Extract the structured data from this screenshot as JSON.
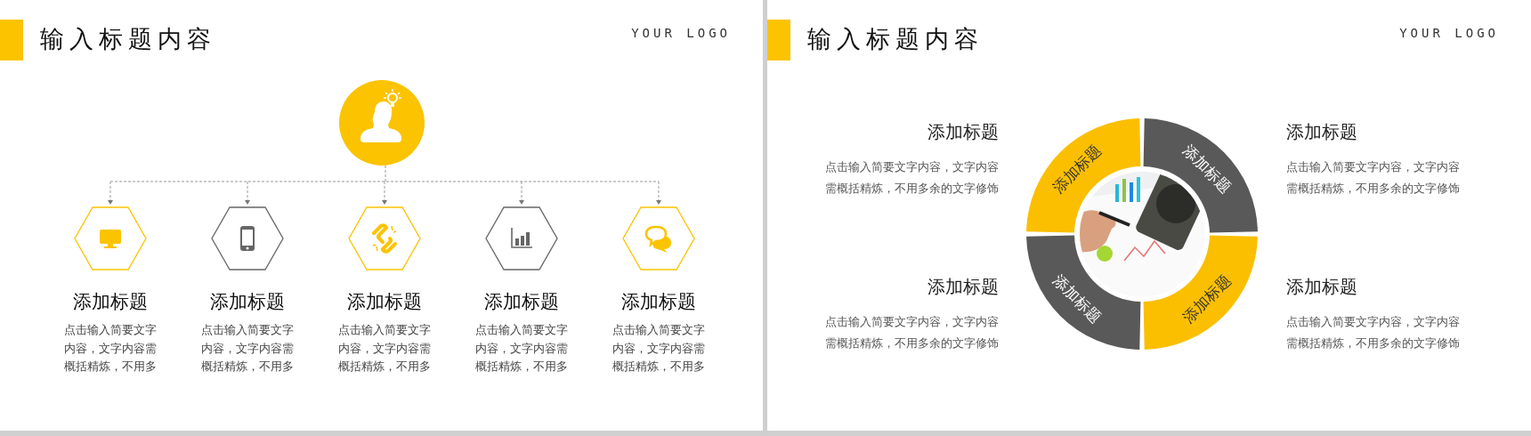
{
  "slides": [
    {
      "kind": "hierarchy",
      "title": "输入标题内容",
      "logo": "YOUR LOGO",
      "items": [
        {
          "title": "添加标题",
          "text": "点击输入简要文字内容，文字内容需概括精炼，不用多",
          "color": "#fbc300"
        },
        {
          "title": "添加标题",
          "text": "点击输入简要文字内容，文字内容需概括精炼，不用多",
          "color": "#666666"
        },
        {
          "title": "添加标题",
          "text": "点击输入简要文字内容，文字内容需概括精炼，不用多",
          "color": "#fbc300"
        },
        {
          "title": "添加标题",
          "text": "点击输入简要文字内容，文字内容需概括精炼，不用多",
          "color": "#666666"
        },
        {
          "title": "添加标题",
          "text": "点击输入简要文字内容，文字内容需概括精炼，不用多",
          "color": "#fbc300"
        }
      ]
    },
    {
      "kind": "puzzle",
      "title": "输入标题内容",
      "logo": "YOUR LOGO",
      "segments": [
        {
          "label": "添加标题",
          "color": "#fbbf00"
        },
        {
          "label": "添加标题",
          "color": "#595959"
        },
        {
          "label": "添加标题",
          "color": "#595959"
        },
        {
          "label": "添加标题",
          "color": "#fbbf00"
        }
      ],
      "notes": [
        {
          "title": "添加标题",
          "text": "点击输入简要文字内容，文字内容需概括精炼，不用多余的文字修饰"
        },
        {
          "title": "添加标题",
          "text": "点击输入简要文字内容，文字内容需概括精炼，不用多余的文字修饰"
        },
        {
          "title": "添加标题",
          "text": "点击输入简要文字内容，文字内容需概括精炼，不用多余的文字修饰"
        },
        {
          "title": "添加标题",
          "text": "点击输入简要文字内容，文字内容需概括精炼，不用多余的文字修饰"
        }
      ]
    }
  ]
}
